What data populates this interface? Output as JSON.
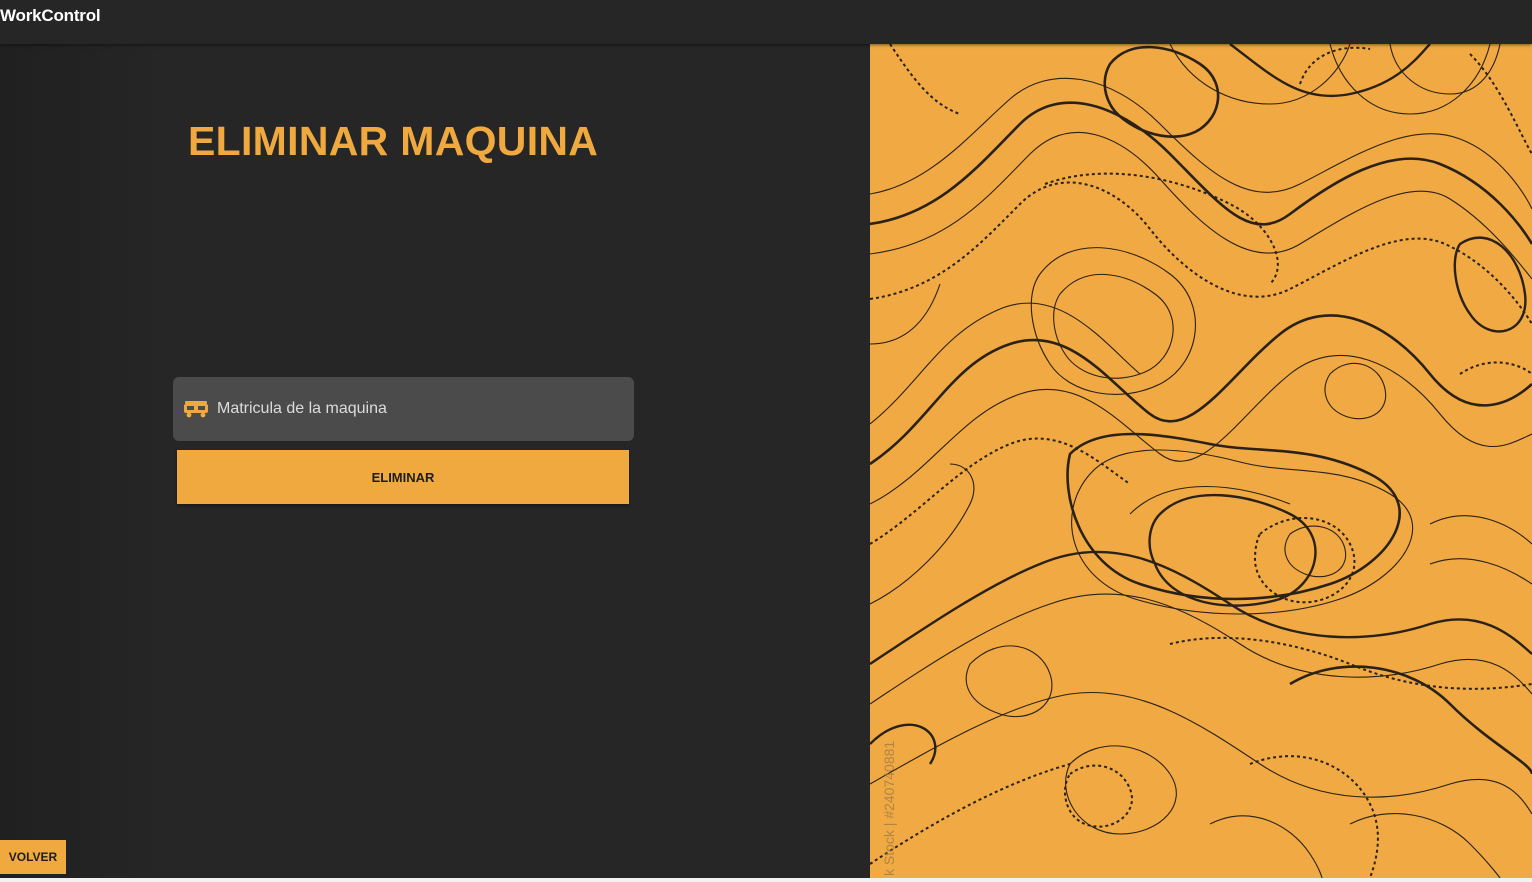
{
  "app": {
    "title": "WorkControl"
  },
  "form": {
    "heading": "ELIMINAR MAQUINA",
    "matricula_placeholder": "Matricula de la maquina",
    "matricula_value": "",
    "submit_label": "ELIMINAR",
    "input_icon": "truck-icon"
  },
  "footer": {
    "back_label": "VOLVER"
  },
  "image": {
    "watermark": "k Stock | #240740881"
  },
  "colors": {
    "accent": "#f0a93f",
    "background": "#242424",
    "input_background": "#4b4b4b",
    "map_background": "#f0a943"
  }
}
